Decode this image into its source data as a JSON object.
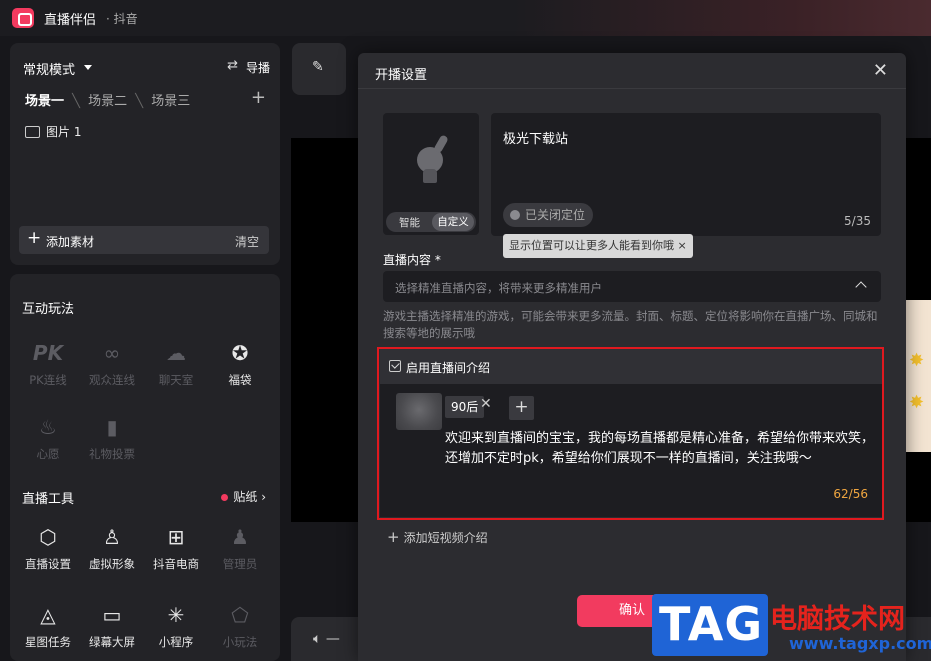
{
  "app": {
    "title": "直播伴侣",
    "subtitle": "· 抖音"
  },
  "scene_panel": {
    "mode_label": "常规模式",
    "import_label": "导播",
    "import_icon": "⇄",
    "scenes": [
      "场景一",
      "场景二",
      "场景三"
    ],
    "sources": [
      "图片 1"
    ],
    "add_material_label": "添加素材",
    "clear_label": "清空"
  },
  "interactive": {
    "title": "互动玩法",
    "items": [
      {
        "label": "PK连线",
        "icon": "PK"
      },
      {
        "label": "观众连线",
        "icon": "∞"
      },
      {
        "label": "聊天室",
        "icon": "☁"
      },
      {
        "label": "福袋",
        "icon": "✪"
      },
      {
        "label": "心愿",
        "icon": "♨"
      },
      {
        "label": "礼物投票",
        "icon": "▮"
      }
    ]
  },
  "live_tools": {
    "title": "直播工具",
    "sticker_label": "贴纸",
    "items": [
      {
        "label": "直播设置",
        "icon": "⬡"
      },
      {
        "label": "虚拟形象",
        "icon": "♙"
      },
      {
        "label": "抖音电商",
        "icon": "⊞"
      },
      {
        "label": "管理员",
        "icon": "♟"
      },
      {
        "label": "星图任务",
        "icon": "◬"
      },
      {
        "label": "绿幕大屏",
        "icon": "▭"
      },
      {
        "label": "小程序",
        "icon": "✳"
      },
      {
        "label": "小玩法",
        "icon": "⬠"
      }
    ]
  },
  "modal": {
    "title": "开播设置",
    "cover_tabs": [
      "智能",
      "自定义"
    ],
    "live_title": "极光下载站",
    "location_label": "已关闭定位",
    "title_count": "5/35",
    "tooltip": "显示位置可以让更多人能看到你哦 ×",
    "content_label": "直播内容 *",
    "content_placeholder": "选择精准直播内容，将带来更多精准用户",
    "hint": "游戏主播选择精准的游戏，可能会带来更多流量。封面、标题、定位将影响你在直播广场、同城和搜索等地的展示哦",
    "intro_label": "启用直播间介绍",
    "tag": "90后",
    "intro_text": "欢迎来到直播间的宝宝，我的每场直播都是精心准备，希望给你带来欢笑，还增加不定时pk，希望给你们展现不一样的直播间，关注我哦～",
    "intro_count": "62/56",
    "add_video_label": "添加短视频介绍",
    "confirm_label": "确认"
  },
  "watermark": {
    "logo": "TAG",
    "site": "电脑技术网",
    "url": "www.tagxp.com"
  }
}
